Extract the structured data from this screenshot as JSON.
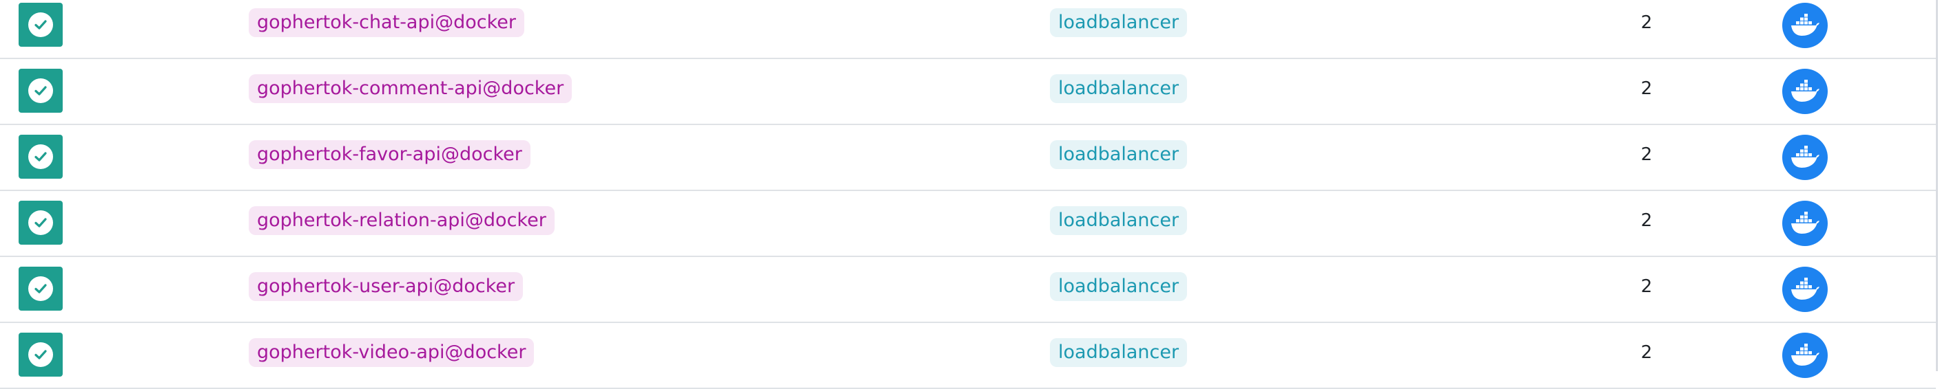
{
  "colors": {
    "status_success": "#1e9e8f",
    "name_chip_bg": "#f7e6f5",
    "name_chip_text": "#a6199c",
    "type_chip_bg": "#e6f4f7",
    "type_chip_text": "#1c99b1",
    "docker_blue": "#1d83f0"
  },
  "rows": [
    {
      "status_icon": "check-icon",
      "name": "gophertok-chat-api@docker",
      "type": "loadbalancer",
      "servers": "2",
      "provider_icon": "docker-icon"
    },
    {
      "status_icon": "check-icon",
      "name": "gophertok-comment-api@docker",
      "type": "loadbalancer",
      "servers": "2",
      "provider_icon": "docker-icon"
    },
    {
      "status_icon": "check-icon",
      "name": "gophertok-favor-api@docker",
      "type": "loadbalancer",
      "servers": "2",
      "provider_icon": "docker-icon"
    },
    {
      "status_icon": "check-icon",
      "name": "gophertok-relation-api@docker",
      "type": "loadbalancer",
      "servers": "2",
      "provider_icon": "docker-icon"
    },
    {
      "status_icon": "check-icon",
      "name": "gophertok-user-api@docker",
      "type": "loadbalancer",
      "servers": "2",
      "provider_icon": "docker-icon"
    },
    {
      "status_icon": "check-icon",
      "name": "gophertok-video-api@docker",
      "type": "loadbalancer",
      "servers": "2",
      "provider_icon": "docker-icon"
    }
  ]
}
